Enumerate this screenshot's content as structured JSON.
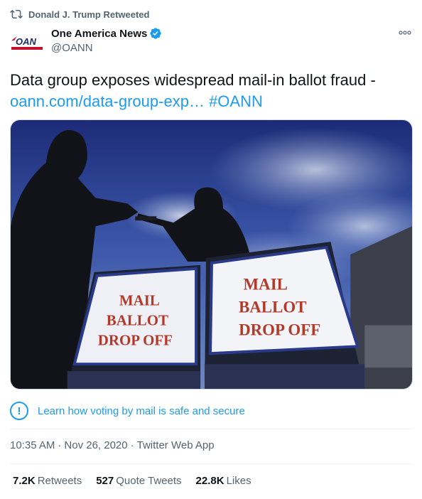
{
  "retweet": {
    "label": "Donald J. Trump Retweeted",
    "icon": "retweet-icon"
  },
  "author": {
    "display_name": "One America News",
    "handle": "@OANN",
    "avatar_text": "OAN",
    "verified": true
  },
  "tweet": {
    "text_prefix": "Data group exposes widespread mail-in ballot fraud -",
    "link_text": "oann.com/data-group-exp…",
    "hashtag": "#OANN"
  },
  "media": {
    "sign_left": [
      "MAIL",
      "BALLOT",
      "DROP OFF"
    ],
    "sign_right": [
      "MAIL",
      "BALLOT",
      "DROP OFF"
    ]
  },
  "notice": {
    "text": "Learn how voting by mail is safe and secure",
    "icon_glyph": "!"
  },
  "meta": {
    "time": "10:35 AM",
    "date": "Nov 26, 2020",
    "source": "Twitter Web App",
    "separator": "·"
  },
  "stats": {
    "retweets_count": "7.2K",
    "retweets_label": "Retweets",
    "quotes_count": "527",
    "quotes_label": "Quote Tweets",
    "likes_count": "22.8K",
    "likes_label": "Likes"
  },
  "colors": {
    "accent": "#1d9bf0",
    "muted": "#536471",
    "text": "#0f1419"
  }
}
